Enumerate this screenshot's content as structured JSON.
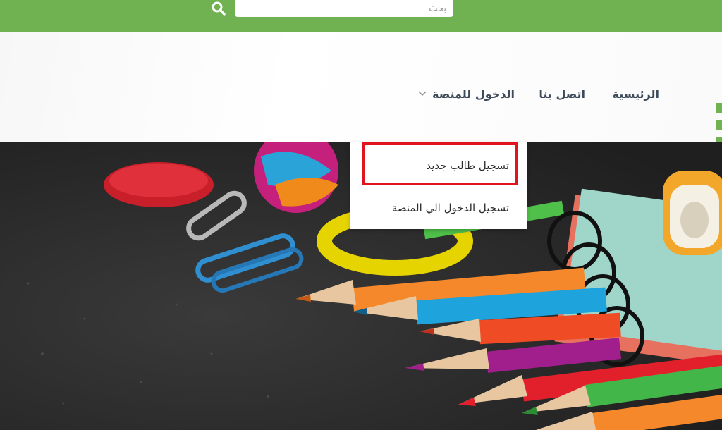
{
  "colors": {
    "accent_green": "#70b152",
    "nav_text": "#3d4a5a",
    "highlight_red": "#e0141e"
  },
  "search": {
    "placeholder": "بحث",
    "icon": "search-icon"
  },
  "nav": {
    "home": "الرئيسية",
    "contact": "اتصل بنا",
    "platform": "الدخول للمنصة",
    "platform_icon": "chevron-down-icon"
  },
  "dropdown": {
    "items": [
      {
        "label": "تسجيل طالب جديد",
        "highlighted": true
      },
      {
        "label": "تسجيل الدخول الي المنصة",
        "highlighted": false
      }
    ]
  }
}
